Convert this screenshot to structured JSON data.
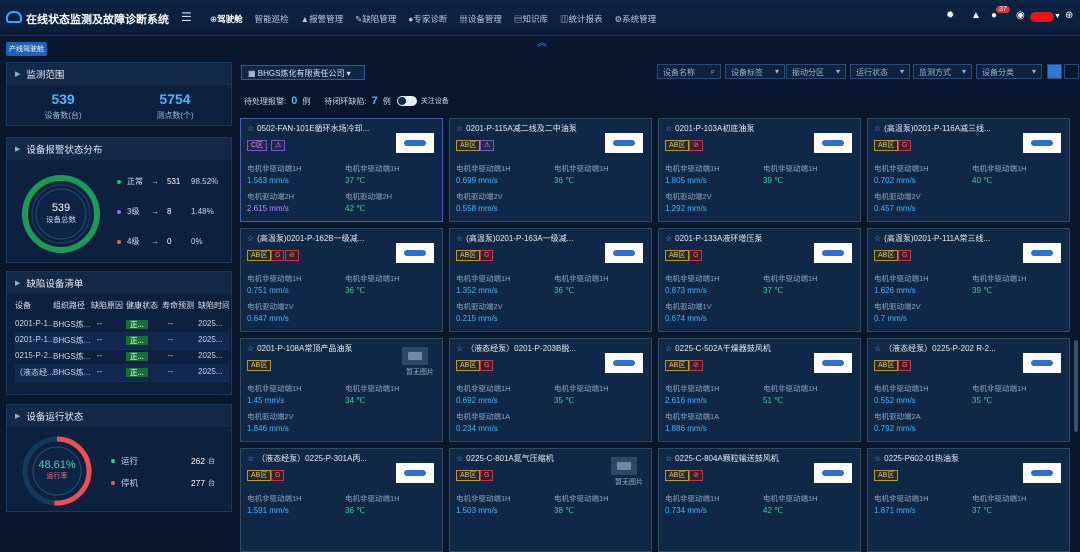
{
  "header": {
    "title": "在线状态监测及故障诊断系统",
    "nav": [
      "驾驶舱",
      "智能巡检",
      "报警管理",
      "缺陷管理",
      "专家诊断",
      "设备管理",
      "知识库",
      "统计报表",
      "系统管理"
    ],
    "badge": "37"
  },
  "tag": "产线驾驶舱",
  "monitor": {
    "title": "监测范围",
    "devices": "539",
    "devices_label": "设备数(台)",
    "points": "5754",
    "points_label": "测点数(个)"
  },
  "alarm_dist": {
    "title": "设备报警状态分布",
    "total": "539",
    "total_label": "设备总数",
    "rows": [
      {
        "label": "正常",
        "count": "531",
        "pct": "98.52%",
        "color": "#22c36b"
      },
      {
        "label": "3级",
        "count": "8",
        "pct": "1.48%",
        "color": "#8b6cff"
      },
      {
        "label": "4级",
        "count": "0",
        "pct": "0%",
        "color": "#ff5467"
      }
    ]
  },
  "defects": {
    "title": "缺陷设备清单",
    "headers": [
      "设备",
      "组织路径",
      "缺陷原因",
      "健康状态",
      "寿命预测",
      "缺陷时间"
    ],
    "rows": [
      [
        "0201-P-1...",
        "BHGS炼...",
        "--",
        "正...",
        "--",
        "2025..."
      ],
      [
        "0201-P-1...",
        "BHGS炼...",
        "--",
        "正...",
        "--",
        "2025..."
      ],
      [
        "0215-P-2...",
        "BHGS炼...",
        "--",
        "正...",
        "--",
        "2025..."
      ],
      [
        "（液态经...",
        "BHGS炼...",
        "--",
        "正...",
        "--",
        "2025..."
      ]
    ]
  },
  "run": {
    "title": "设备运行状态",
    "rate": "48.61%",
    "rate_label": "运行率",
    "rows": [
      {
        "label": "运行",
        "value": "262",
        "unit": "台",
        "color": "#37c98a"
      },
      {
        "label": "停机",
        "value": "277",
        "unit": "台",
        "color": "#ff5467"
      }
    ]
  },
  "main": {
    "company": "BHGS炼化有限责任公司",
    "pending_label": "待处理报警:",
    "pending": "0",
    "pending_unit": "例",
    "closing_label": "待闭环缺陷:",
    "closing": "7",
    "closing_unit": "例",
    "follow_label": "关注设备",
    "filters": [
      "设备名称",
      "设备标签",
      "振动分区",
      "运行状态",
      "监测方式",
      "设备分类"
    ]
  },
  "cards": [
    {
      "title": "0502-FAN-101E循环水场冷却...",
      "pills": [
        "C区",
        "⚠"
      ],
      "m": [
        [
          "电机非驱动端1H",
          "1.563 mm/s"
        ],
        [
          "电机非驱动端1H",
          "37 ℃"
        ],
        [
          "电机驱动端2H",
          "2.615 mm/s"
        ],
        [
          "电机驱动端2H",
          "42 ℃"
        ]
      ]
    },
    {
      "title": "0201-P-115A减二线及二中油泵",
      "pills": [
        "AB区",
        "⚠"
      ],
      "m": [
        [
          "电机非驱动端1H",
          "0.699 mm/s"
        ],
        [
          "电机非驱动端1H",
          "36 ℃"
        ],
        [
          "电机驱动端2V",
          "0.558 mm/s"
        ]
      ]
    },
    {
      "title": "0201-P-103A初底油泵",
      "pills": [
        "AB区",
        "⊘"
      ],
      "m": [
        [
          "电机非驱动端1H",
          "1.805 mm/s"
        ],
        [
          "电机非驱动端1H",
          "39 ℃"
        ],
        [
          "电机驱动端2V",
          "1.292 mm/s"
        ]
      ]
    },
    {
      "title": "(高温泵)0201-P-116A减三线...",
      "pills": [
        "AB区",
        "G"
      ],
      "m": [
        [
          "电机非驱动端1H",
          "0.702 mm/s"
        ],
        [
          "电机非驱动端1H",
          "40 ℃"
        ],
        [
          "电机驱动端2V",
          "0.457 mm/s"
        ]
      ]
    },
    {
      "title": "(高温泵)0201-P-162B一级减...",
      "pills": [
        "AB区",
        "G",
        "⊘"
      ],
      "m": [
        [
          "电机非驱动端1H",
          "0.751 mm/s"
        ],
        [
          "电机非驱动端1H",
          "36 ℃"
        ],
        [
          "电机驱动端2V",
          "0.647 mm/s"
        ]
      ]
    },
    {
      "title": "(高温泵)0201-P-163A一级减...",
      "pills": [
        "AB区",
        "G"
      ],
      "m": [
        [
          "电机非驱动端1H",
          "1.352 mm/s"
        ],
        [
          "电机非驱动端1H",
          "36 ℃"
        ],
        [
          "电机驱动端2V",
          "0.215 mm/s"
        ]
      ]
    },
    {
      "title": "0201-P-133A液环增压泵",
      "pills": [
        "AB区",
        "G"
      ],
      "m": [
        [
          "电机非驱动端1H",
          "0.873 mm/s"
        ],
        [
          "电机非驱动端1H",
          "37 ℃"
        ],
        [
          "电机驱动端1V",
          "0.674 mm/s"
        ]
      ]
    },
    {
      "title": "(高温泵)0201-P-111A常三线...",
      "pills": [
        "AB区",
        "G"
      ],
      "m": [
        [
          "电机非驱动端1H",
          "1.626 mm/s"
        ],
        [
          "电机非驱动端1H",
          "39 ℃"
        ],
        [
          "电机驱动端2V",
          "0.7 mm/s"
        ]
      ]
    },
    {
      "title": "0201-P-108A常顶产品油泵",
      "pills": [
        "AB区"
      ],
      "noimg": "暂无图片",
      "m": [
        [
          "电机非驱动端1H",
          "1.45 mm/s"
        ],
        [
          "电机非驱动端1H",
          "34 ℃"
        ],
        [
          "电机驱动端2V",
          "1.846 mm/s"
        ]
      ]
    },
    {
      "title": "（液态经泵）0201-P-203B脱...",
      "pills": [
        "AB区",
        "G"
      ],
      "m": [
        [
          "电机非驱动端1H",
          "0.692 mm/s"
        ],
        [
          "电机非驱动端1H",
          "35 ℃"
        ],
        [
          "电机非驱动端1A",
          "0.234 mm/s"
        ]
      ]
    },
    {
      "title": "0225-C-502A干燥器鼓风机",
      "pills": [
        "AB区",
        "⊘"
      ],
      "m": [
        [
          "电机非驱动端1H",
          "2.616 mm/s"
        ],
        [
          "电机非驱动端1H",
          "51 ℃"
        ],
        [
          "电机非驱动端1A",
          "1.886 mm/s"
        ]
      ]
    },
    {
      "title": "（液态经泵）0225-P-202 R-2...",
      "pills": [
        "AB区",
        "G"
      ],
      "m": [
        [
          "电机非驱动端1H",
          "0.552 mm/s"
        ],
        [
          "电机非驱动端1H",
          "35 ℃"
        ],
        [
          "电机驱动端2A",
          "0.792 mm/s"
        ]
      ]
    },
    {
      "title": "（液态经泵）0225-P-301A丙...",
      "pills": [
        "AB区",
        "G"
      ],
      "m": [
        [
          "电机非驱动端1H",
          "1.591 mm/s"
        ],
        [
          "电机非驱动端1H",
          "36 ℃"
        ]
      ]
    },
    {
      "title": "0225-C-801A氮气压缩机",
      "pills": [
        "AB区",
        "G"
      ],
      "noimg": "暂无图片",
      "m": [
        [
          "电机非驱动端1H",
          "1.503 mm/s"
        ],
        [
          "电机非驱动端1H",
          "38 ℃"
        ]
      ]
    },
    {
      "title": "0225-C-804A颗粒输送鼓风机",
      "pills": [
        "AB区",
        "⊘"
      ],
      "m": [
        [
          "电机非驱动端1H",
          "0.734 mm/s"
        ],
        [
          "电机非驱动端1H",
          "42 ℃"
        ]
      ]
    },
    {
      "title": "0225-P602-01热油泵",
      "pills": [
        "AB区"
      ],
      "m": [
        [
          "电机非驱动端1H",
          "1.871 mm/s"
        ],
        [
          "电机非驱动端1H",
          "37 ℃"
        ]
      ]
    }
  ]
}
